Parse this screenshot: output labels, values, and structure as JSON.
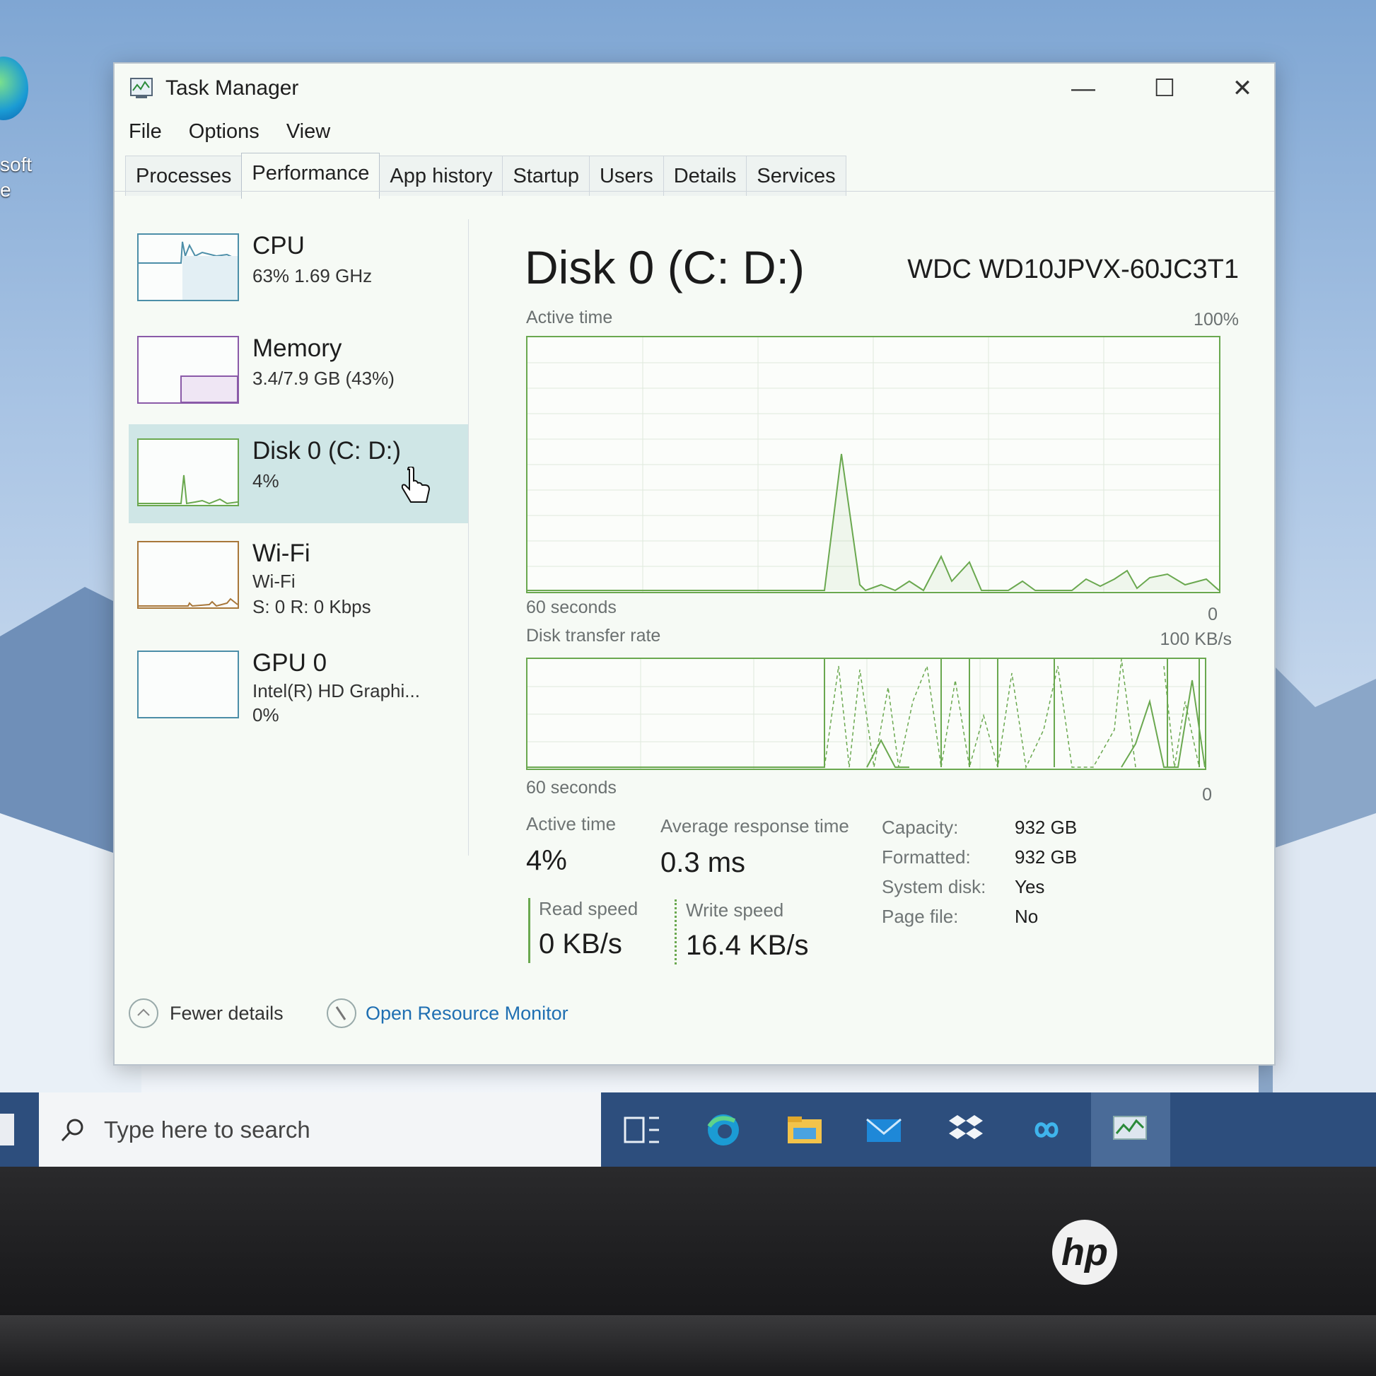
{
  "window": {
    "title": "Task Manager",
    "controls": {
      "minimize": "—",
      "maximize": "☐",
      "close": "✕"
    }
  },
  "menu": [
    "File",
    "Options",
    "View"
  ],
  "tabs": [
    "Processes",
    "Performance",
    "App history",
    "Startup",
    "Users",
    "Details",
    "Services"
  ],
  "active_tab": "Performance",
  "sidebar": {
    "items": [
      {
        "name": "CPU",
        "line1": "63%  1.69 GHz",
        "line2": ""
      },
      {
        "name": "Memory",
        "line1": "3.4/7.9 GB (43%)",
        "line2": ""
      },
      {
        "name": "Disk 0 (C: D:)",
        "line1": "4%",
        "line2": ""
      },
      {
        "name": "Wi-Fi",
        "line1": "Wi-Fi",
        "line2": "S: 0  R: 0 Kbps"
      },
      {
        "name": "GPU 0",
        "line1": "Intel(R) HD Graphi...",
        "line2": "0%"
      }
    ]
  },
  "main": {
    "title": "Disk 0 (C: D:)",
    "model": "WDC WD10JPVX-60JC3T1",
    "active_graph": {
      "label": "Active time",
      "max_label": "100%",
      "time_label": "60 seconds",
      "min_label": "0"
    },
    "transfer_graph": {
      "label": "Disk transfer rate",
      "max_label": "100 KB/s",
      "time_label": "60 seconds",
      "min_label": "0"
    },
    "stats": {
      "active_time_label": "Active time",
      "active_time_value": "4%",
      "avg_response_label": "Average response time",
      "avg_response_value": "0.3 ms",
      "read_label": "Read speed",
      "read_value": "0 KB/s",
      "write_label": "Write speed",
      "write_value": "16.4 KB/s"
    },
    "info": [
      {
        "label": "Capacity:",
        "value": "932 GB"
      },
      {
        "label": "Formatted:",
        "value": "932 GB"
      },
      {
        "label": "System disk:",
        "value": "Yes"
      },
      {
        "label": "Page file:",
        "value": "No"
      }
    ]
  },
  "footer": {
    "fewer_details": "Fewer details",
    "resource_monitor": "Open Resource Monitor"
  },
  "taskbar": {
    "search_placeholder": "Type here to search"
  },
  "desktop": {
    "icon_label_line1": "soft",
    "icon_label_line2": "e"
  },
  "laptop": {
    "logo": "hp"
  },
  "colors": {
    "accent_green": "#6aa84f",
    "sidebar_selected": "#cfe6e6",
    "link": "#1f6fb2",
    "taskbar": "#2d4e7d"
  }
}
